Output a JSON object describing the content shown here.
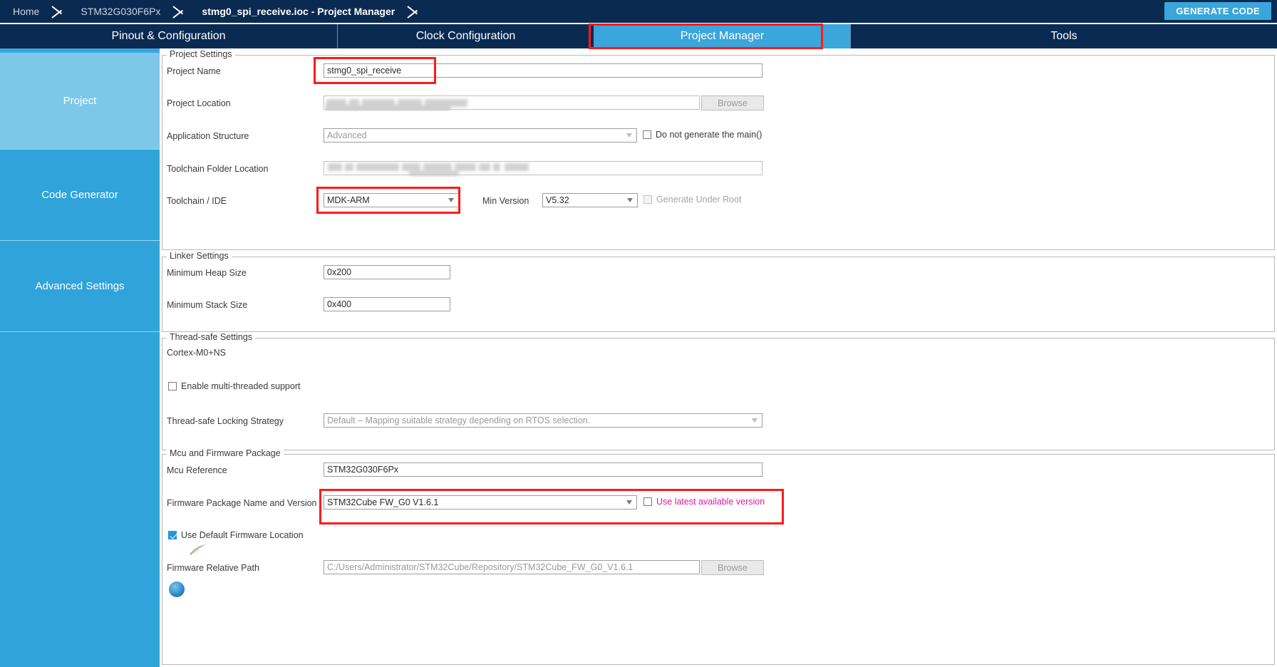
{
  "breadcrumb": {
    "items": [
      {
        "label": "Home",
        "active": false
      },
      {
        "label": "STM32G030F6Px",
        "active": false
      },
      {
        "label": "stmg0_spi_receive.ioc - Project Manager",
        "active": true
      }
    ],
    "generate_code_label": "GENERATE CODE"
  },
  "tabs": [
    {
      "label": "Pinout & Configuration",
      "selected": false
    },
    {
      "label": "Clock Configuration",
      "selected": false
    },
    {
      "label": "Project Manager",
      "selected": true
    },
    {
      "label": "Tools",
      "selected": false
    }
  ],
  "sidebar": {
    "items": [
      {
        "label": "Project",
        "selected": true
      },
      {
        "label": "Code Generator",
        "selected": false
      },
      {
        "label": "Advanced Settings",
        "selected": false
      },
      {
        "label": "",
        "selected": false
      }
    ]
  },
  "project_settings": {
    "title": "Project Settings",
    "project_name_label": "Project Name",
    "project_name_value": "stmg0_spi_receive",
    "project_location_label": "Project Location",
    "project_location_value": "",
    "project_location_browse": "Browse",
    "application_structure_label": "Application Structure",
    "application_structure_value": "Advanced",
    "do_not_generate_main_label": "Do not generate the main()",
    "toolchain_folder_label": "Toolchain Folder Location",
    "toolchain_folder_value": "",
    "toolchain_ide_label": "Toolchain / IDE",
    "toolchain_ide_value": "MDK-ARM",
    "min_version_label": "Min Version",
    "min_version_value": "V5.32",
    "generate_under_root_label": "Generate Under Root"
  },
  "linker_settings": {
    "title": "Linker Settings",
    "heap_label": "Minimum Heap Size",
    "heap_value": "0x200",
    "stack_label": "Minimum Stack Size",
    "stack_value": "0x400"
  },
  "thread_safe_settings": {
    "title": "Thread-safe Settings",
    "core_label": "Cortex-M0+NS",
    "enable_multithread_label": "Enable multi-threaded support",
    "locking_strategy_label": "Thread-safe Locking Strategy",
    "locking_strategy_value": "Default – Mapping suitable strategy depending on RTOS selection."
  },
  "mcu_firmware": {
    "title": "Mcu and Firmware Package",
    "mcu_reference_label": "Mcu Reference",
    "mcu_reference_value": "STM32G030F6Px",
    "firmware_package_label": "Firmware Package Name and Version",
    "firmware_package_value": "STM32Cube FW_G0 V1.6.1",
    "use_latest_label": "Use latest available version",
    "use_default_location_label": "Use Default Firmware Location",
    "firmware_relative_path_label": "Firmware Relative Path",
    "firmware_relative_path_value": "C:/Users/Administrator/STM32Cube/Repository/STM32Cube_FW_G0_V1.6.1",
    "firmware_relative_path_browse": "Browse"
  },
  "colors": {
    "header_navy": "#0b2a52",
    "accent_blue": "#3aa6dc",
    "sidebar_blue": "#2fa3da",
    "sidebar_selected": "#7dc8e8",
    "annotation_red": "#ff1a1a",
    "magenta": "#e5179b"
  }
}
